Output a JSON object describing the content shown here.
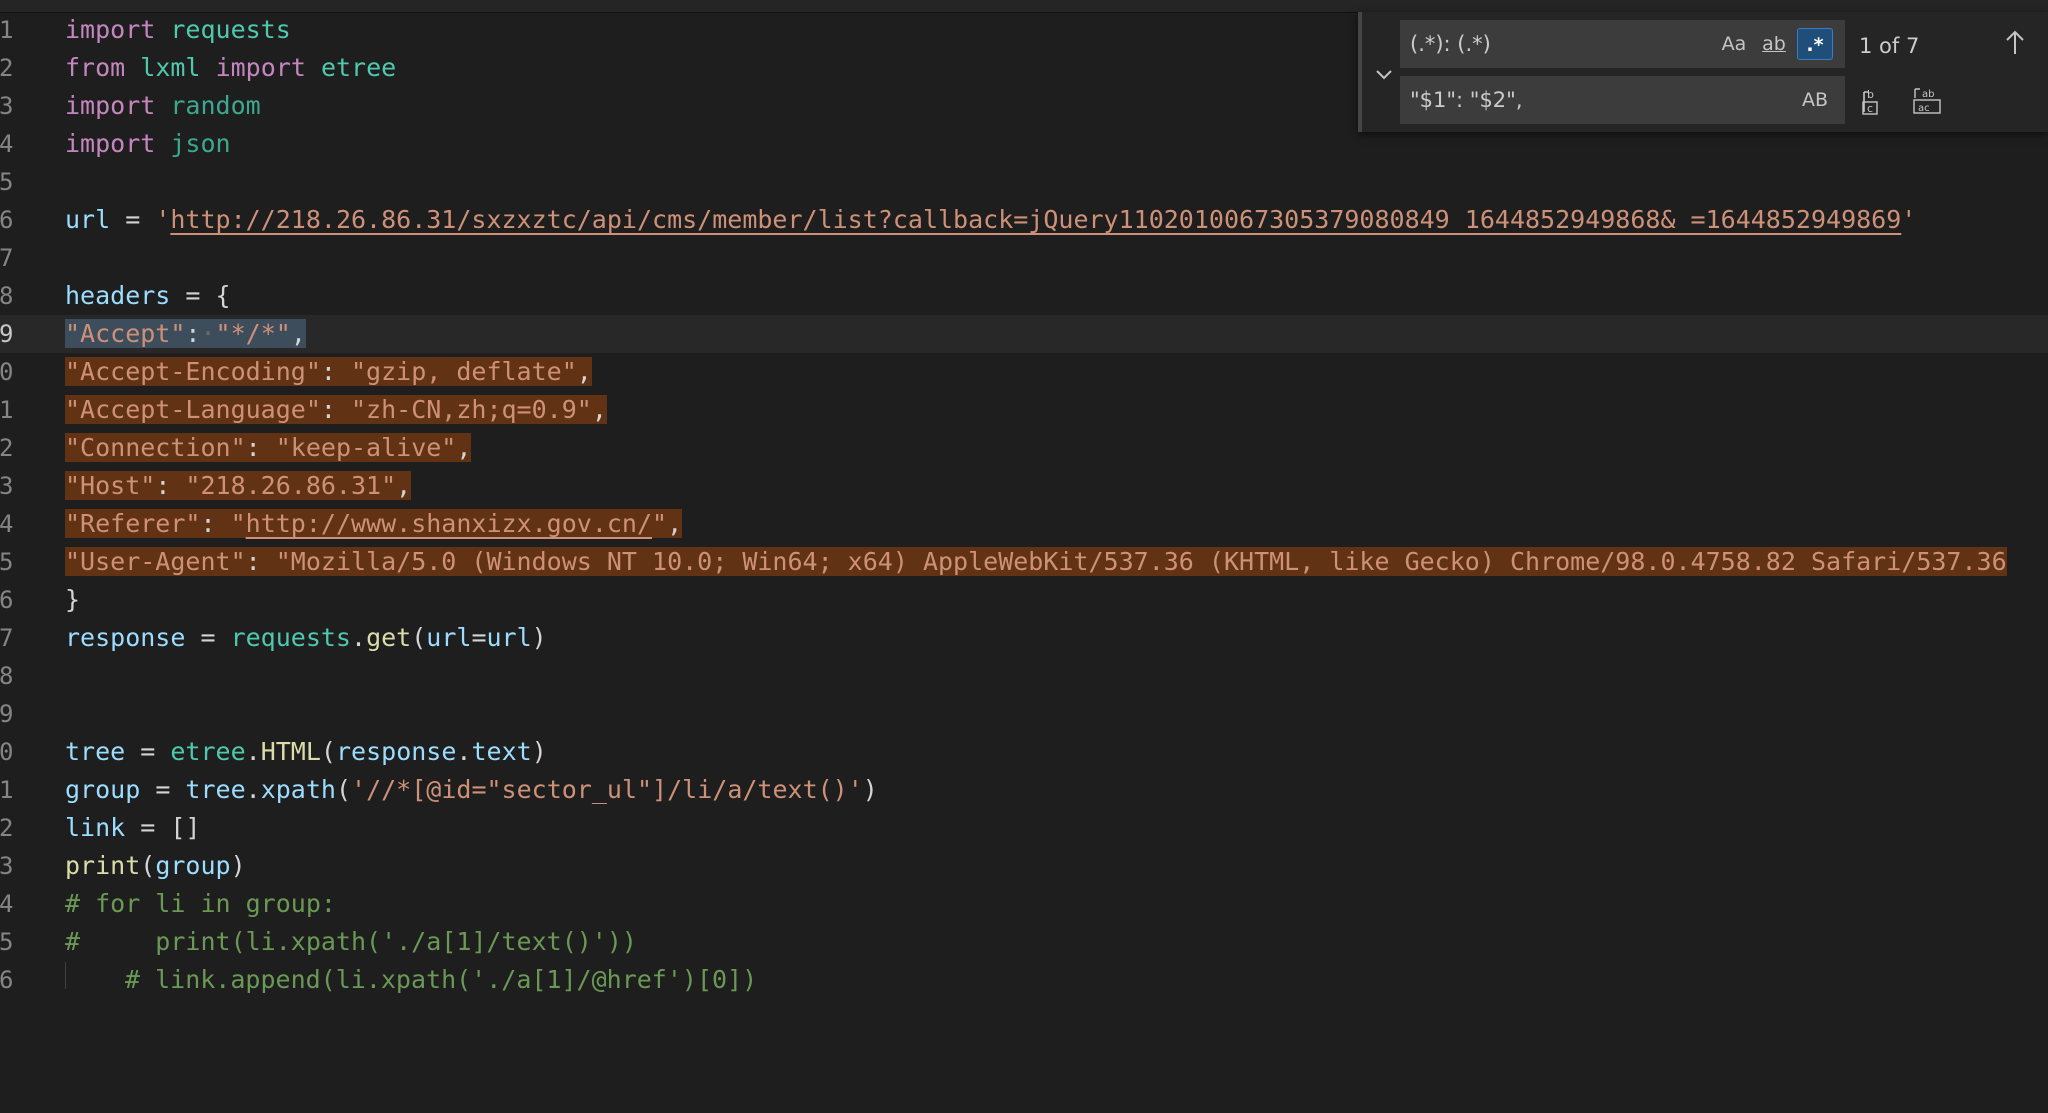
{
  "editor": {
    "lines": [
      {
        "num": "1"
      },
      {
        "num": "2"
      },
      {
        "num": "3"
      },
      {
        "num": "4"
      },
      {
        "num": "5"
      },
      {
        "num": "6"
      },
      {
        "num": "7"
      },
      {
        "num": "8"
      },
      {
        "num": "9"
      },
      {
        "num": "0"
      },
      {
        "num": "1"
      },
      {
        "num": "2"
      },
      {
        "num": "3"
      },
      {
        "num": "4"
      },
      {
        "num": "5"
      },
      {
        "num": "6"
      },
      {
        "num": "7"
      },
      {
        "num": "8"
      },
      {
        "num": "9"
      },
      {
        "num": "0"
      },
      {
        "num": "1"
      },
      {
        "num": "2"
      },
      {
        "num": "3"
      },
      {
        "num": "4"
      },
      {
        "num": "5"
      },
      {
        "num": "6"
      }
    ],
    "tok": {
      "import": "import",
      "from": "from",
      "requests": "requests",
      "lxml": "lxml",
      "etree": "etree",
      "random": "random",
      "json": "json",
      "url": "url",
      "eq": " = ",
      "url_q1": "'",
      "url_str": "http://218.26.86.31/sxzxztc/api/cms/member/list?callback=jQuery110201006730537908084​9_1644852949868&_=1644852949869",
      "url_q2": "'",
      "headers": "headers",
      "brace_open": " = {",
      "brace_close": "}",
      "accept_key": "\"Accept\"",
      "accept_colon": ":",
      "accept_space": "·",
      "accept_val": "\"*/*\"",
      "comma": ",",
      "enc_key": "\"Accept-Encoding\"",
      "enc_val": "\"gzip, deflate\"",
      "lang_key": "\"Accept-Language\"",
      "lang_val": "\"zh-CN,zh;q=0.9\"",
      "conn_key": "\"Connection\"",
      "conn_val": "\"keep-alive\"",
      "host_key": "\"Host\"",
      "host_val": "\"218.26.86.31\"",
      "ref_key": "\"Referer\"",
      "ref_q1": "\"",
      "ref_url": "http://www.shanxizx.gov.cn/",
      "ref_q2": "\"",
      "ua_key": "\"User-Agent\"",
      "ua_val": "\"Mozilla/5.0 (Windows NT 10.0; Win64; x64) AppleWebKit/537.36 (KHTML, like Gecko) Chrome/98.0.4758.82 Safari/537.36",
      "kv_sep": ": ",
      "response": "response",
      "get": "get",
      "dot": ".",
      "lp": "(",
      "rp": ")",
      "kw_eq": "=",
      "tree": "tree",
      "HTML": "HTML",
      "text": "text",
      "group": "group",
      "xpath": "xpath",
      "xpath_str": "'//*[@id=\"sector_ul\"]/li/a/text()'",
      "link": "link",
      "empty_list": " = []",
      "print": "print",
      "c1": "# for li in group:",
      "c2": "#     print(li.xpath('./a[1]/text()'))",
      "c3": "# link.append(li.xpath('./a[1]/@href')[0])"
    }
  },
  "find_widget": {
    "find_value": "(.*): (.*)",
    "replace_value": "\"$1\": \"$2\",",
    "match_case_label": "Aa",
    "whole_word_label": "ab",
    "regex_label": ".*",
    "preserve_case_label": "AB",
    "match_count": "1 of 7"
  }
}
